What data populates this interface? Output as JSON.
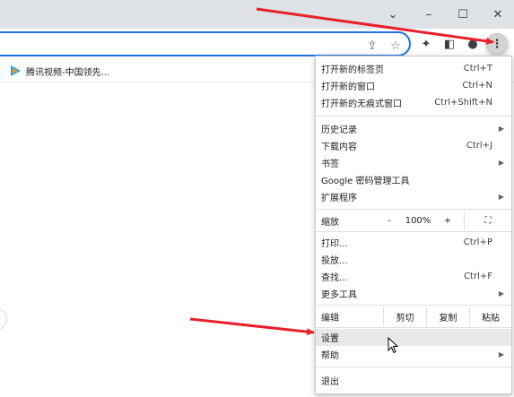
{
  "window_controls": [
    {
      "name": "tab-search-icon",
      "glyph": "⌄"
    },
    {
      "name": "minimize-icon",
      "glyph": "–"
    },
    {
      "name": "maximize-icon",
      "glyph": "☐"
    },
    {
      "name": "close-icon",
      "glyph": "✕"
    }
  ],
  "toolbar": {
    "share_glyph": "⇪",
    "star_glyph": "☆",
    "extensions_glyph": "✦",
    "sidepanel_glyph": "◧",
    "profile_glyph": "●",
    "menu_glyph": "⋮"
  },
  "bookmarks": {
    "items": [
      {
        "label": "腾讯视频-中国领先...",
        "icon": "tencent-video-icon"
      }
    ]
  },
  "menu": {
    "new_tab": {
      "label": "打开新的标签页",
      "shortcut": "Ctrl+T"
    },
    "new_window": {
      "label": "打开新的窗口",
      "shortcut": "Ctrl+N"
    },
    "new_incognito": {
      "label": "打开新的无痕式窗口",
      "shortcut": "Ctrl+Shift+N"
    },
    "history": {
      "label": "历史记录"
    },
    "downloads": {
      "label": "下载内容",
      "shortcut": "Ctrl+J"
    },
    "bookmarks": {
      "label": "书签"
    },
    "password_manager": {
      "label": "Google 密码管理工具"
    },
    "extensions": {
      "label": "扩展程序"
    },
    "zoom": {
      "label": "缩放",
      "minus": "-",
      "value": "100%",
      "plus": "+",
      "fullscreen_glyph": "⛶"
    },
    "print": {
      "label": "打印...",
      "shortcut": "Ctrl+P"
    },
    "cast": {
      "label": "投放..."
    },
    "find": {
      "label": "查找...",
      "shortcut": "Ctrl+F"
    },
    "more_tools": {
      "label": "更多工具"
    },
    "edit": {
      "label": "编辑",
      "cut": "剪切",
      "copy": "复制",
      "paste": "粘贴"
    },
    "settings": {
      "label": "设置"
    },
    "help": {
      "label": "帮助"
    },
    "exit": {
      "label": "退出"
    },
    "arrow_glyph": "▶"
  },
  "colors": {
    "annotation_arrow": "#e8202a",
    "accent": "#1a73e8"
  }
}
